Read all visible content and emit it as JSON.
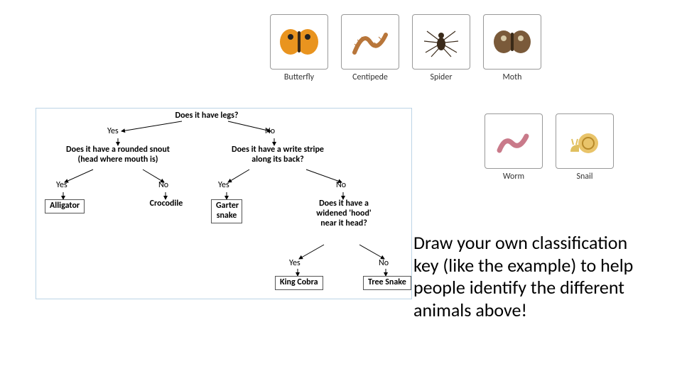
{
  "animals_row1": [
    {
      "name": "Butterfly"
    },
    {
      "name": "Centipede"
    },
    {
      "name": "Spider"
    },
    {
      "name": "Moth"
    }
  ],
  "animals_row2": [
    {
      "name": "Worm"
    },
    {
      "name": "Snail"
    }
  ],
  "key": {
    "root": "Does it have legs?",
    "root_yes": "Yes",
    "root_no": "No",
    "q_left": "Does it have a rounded snout (head where mouth is)",
    "q_right": "Does it have a write stripe along its back?",
    "left_yes": "Yes",
    "left_no": "No",
    "right_yes": "Yes",
    "right_no": "No",
    "leaf_alligator": "Alligator",
    "leaf_crocodile": "Crocodile",
    "leaf_garter": "Garter snake",
    "q_hood": "Does it have a widened 'hood' near it head?",
    "hood_yes": "Yes",
    "hood_no": "No",
    "leaf_cobra": "King Cobra",
    "leaf_tree": "Tree Snake"
  },
  "instruction": "Draw your own classification key (like the example) to help people identify the different animals above!"
}
